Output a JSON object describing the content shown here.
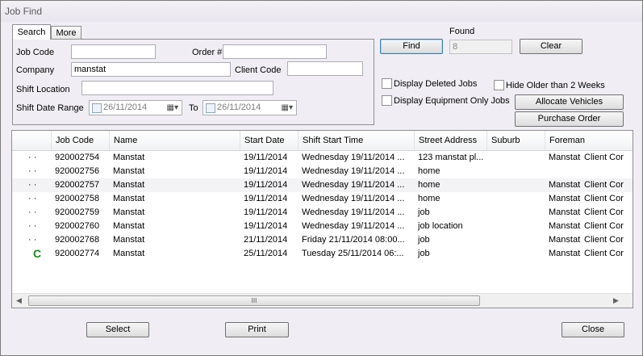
{
  "window": {
    "title": "Job Find"
  },
  "tabs": [
    {
      "label": "Search"
    },
    {
      "label": "More"
    }
  ],
  "search": {
    "job_code_label": "Job Code",
    "job_code_value": "",
    "order_label": "Order #",
    "order_value": "",
    "company_label": "Company",
    "company_value": "manstat",
    "client_code_label": "Client Code",
    "client_code_value": "",
    "shift_location_label": "Shift Location",
    "shift_location_value": "",
    "shift_date_range_label": "Shift Date Range",
    "date_from": "26/11/2014",
    "to_label": "To",
    "date_to": "26/11/2014"
  },
  "actions": {
    "find_label": "Find",
    "found_label": "Found",
    "found_value": "8",
    "clear_label": "Clear",
    "display_deleted_label": "Display Deleted Jobs",
    "hide_older_label": "Hide Older than 2 Weeks",
    "display_equipment_label": "Display Equipment Only Jobs",
    "allocate_label": "Allocate Vehicles",
    "purchase_label": "Purchase Order"
  },
  "grid": {
    "columns": [
      "Job Code",
      "Name",
      "Start Date",
      "Shift Start Time",
      "Street Address",
      "Suburb",
      "Foreman"
    ],
    "rows": [
      {
        "status": "· ·",
        "job": "920002754",
        "name": "Manstat",
        "date": "19/11/2014",
        "time": "Wednesday 19/11/2014 ...",
        "street": "123 manstat pl...",
        "suburb": "",
        "foreman": "Manstat",
        "extra": "Client Cor"
      },
      {
        "status": "· ·",
        "job": "920002756",
        "name": "Manstat",
        "date": "19/11/2014",
        "time": "Wednesday 19/11/2014 ...",
        "street": "home",
        "suburb": "",
        "foreman": "",
        "extra": ""
      },
      {
        "status": "· ·",
        "job": "920002757",
        "name": "Manstat",
        "date": "19/11/2014",
        "time": "Wednesday 19/11/2014 ...",
        "street": "home",
        "suburb": "",
        "foreman": "Manstat",
        "extra": "Client Cor"
      },
      {
        "status": "· ·",
        "job": "920002758",
        "name": "Manstat",
        "date": "19/11/2014",
        "time": "Wednesday 19/11/2014 ...",
        "street": "home",
        "suburb": "",
        "foreman": "Manstat",
        "extra": "Client Cor"
      },
      {
        "status": "· ·",
        "job": "920002759",
        "name": "Manstat",
        "date": "19/11/2014",
        "time": "Wednesday 19/11/2014 ...",
        "street": "job",
        "suburb": "",
        "foreman": "Manstat",
        "extra": "Client Cor"
      },
      {
        "status": "· ·",
        "job": "920002760",
        "name": "Manstat",
        "date": "19/11/2014",
        "time": "Wednesday 19/11/2014 ...",
        "street": "job location",
        "suburb": "",
        "foreman": "Manstat",
        "extra": "Client Cor"
      },
      {
        "status": "· ·",
        "job": "920002768",
        "name": "Manstat",
        "date": "21/11/2014",
        "time": "Friday 21/11/2014 08:00...",
        "street": "job",
        "suburb": "",
        "foreman": "Manstat",
        "extra": "Client Cor"
      },
      {
        "status": "C",
        "job": "920002774",
        "name": "Manstat",
        "date": "25/11/2014",
        "time": "Tuesday 25/11/2014 06:...",
        "street": "job",
        "suburb": "",
        "foreman": "Manstat",
        "extra": "Client Cor"
      }
    ],
    "scroll_grip": "III"
  },
  "footer": {
    "select_label": "Select",
    "print_label": "Print",
    "close_label": "Close"
  },
  "colors": {
    "status_c": "#1a8a1a",
    "default_button_border": "#3c7fb1"
  }
}
